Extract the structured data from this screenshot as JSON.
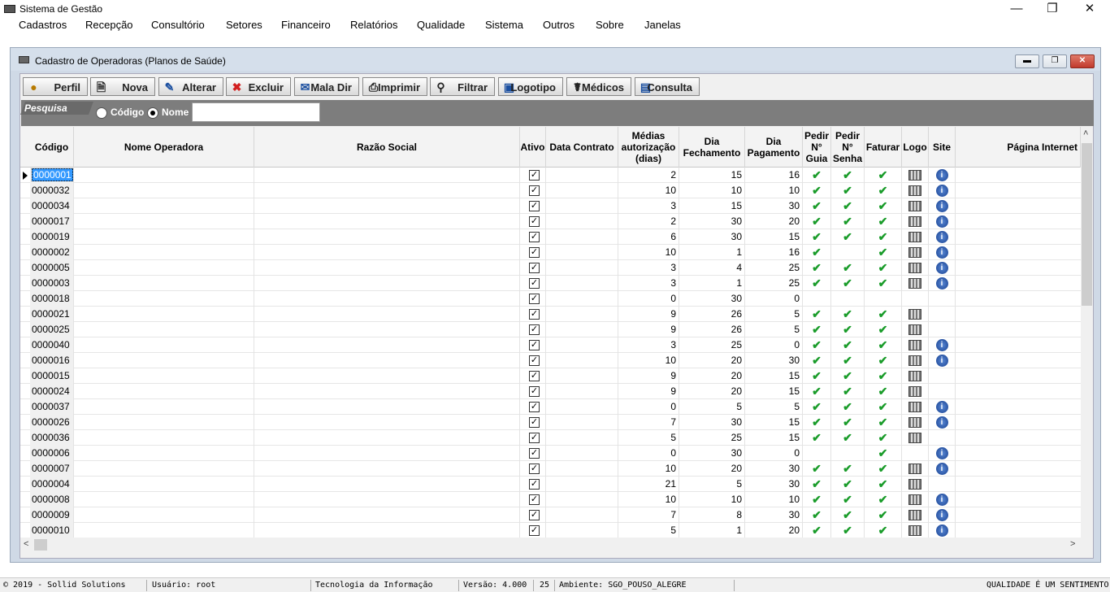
{
  "app": {
    "title": "Sistema de Gestão"
  },
  "menu": [
    "Cadastros",
    "Recepção",
    "Consultório",
    "Setores",
    "Financeiro",
    "Relatórios",
    "Qualidade",
    "Sistema",
    "Outros",
    "Sobre",
    "Janelas"
  ],
  "window": {
    "title": "Cadastro de Operadoras (Planos de Saúde)"
  },
  "toolbar": {
    "perfil": "Perfil",
    "nova": "Nova",
    "alterar": "Alterar",
    "excluir": "Excluir",
    "mala_dir": "Mala Dir",
    "imprimir": "Imprimir",
    "filtrar": "Filtrar",
    "logotipo": "Logotipo",
    "medicos": "Médicos",
    "consulta": "Consulta"
  },
  "search": {
    "label": "Pesquisa",
    "option_codigo": "Código",
    "option_nome": "Nome",
    "selected": "Nome",
    "value": ""
  },
  "columns": {
    "codigo": "Código",
    "nome": "Nome Operadora",
    "razao": "Razão Social",
    "ativo": "Ativo",
    "data_contrato": "Data Contrato",
    "medias": "Médias autorização (dias)",
    "dia_fechamento": "Dia Fechamento",
    "dia_pagamento": "Dia Pagamento",
    "pedir_guia": "Pedir N° Guia",
    "pedir_senha": "Pedir N° Senha",
    "faturar": "Faturar",
    "logo": "Logo",
    "site": "Site",
    "pagina": "Página Internet"
  },
  "rows": [
    {
      "codigo": "0000001",
      "medias": "2",
      "fech": "15",
      "pag": "16",
      "guia": true,
      "senha": true,
      "fat": true,
      "logo": true,
      "site": true
    },
    {
      "codigo": "0000032",
      "medias": "10",
      "fech": "10",
      "pag": "10",
      "guia": true,
      "senha": true,
      "fat": true,
      "logo": true,
      "site": true
    },
    {
      "codigo": "0000034",
      "medias": "3",
      "fech": "15",
      "pag": "30",
      "guia": true,
      "senha": true,
      "fat": true,
      "logo": true,
      "site": true
    },
    {
      "codigo": "0000017",
      "medias": "2",
      "fech": "30",
      "pag": "20",
      "guia": true,
      "senha": true,
      "fat": true,
      "logo": true,
      "site": true
    },
    {
      "codigo": "0000019",
      "medias": "6",
      "fech": "30",
      "pag": "15",
      "guia": true,
      "senha": true,
      "fat": true,
      "logo": true,
      "site": true
    },
    {
      "codigo": "0000002",
      "medias": "10",
      "fech": "1",
      "pag": "16",
      "guia": true,
      "senha": false,
      "fat": true,
      "logo": true,
      "site": true
    },
    {
      "codigo": "0000005",
      "medias": "3",
      "fech": "4",
      "pag": "25",
      "guia": true,
      "senha": true,
      "fat": true,
      "logo": true,
      "site": true
    },
    {
      "codigo": "0000003",
      "medias": "3",
      "fech": "1",
      "pag": "25",
      "guia": true,
      "senha": true,
      "fat": true,
      "logo": true,
      "site": true
    },
    {
      "codigo": "0000018",
      "medias": "0",
      "fech": "30",
      "pag": "0",
      "guia": false,
      "senha": false,
      "fat": false,
      "logo": false,
      "site": false
    },
    {
      "codigo": "0000021",
      "medias": "9",
      "fech": "26",
      "pag": "5",
      "guia": true,
      "senha": true,
      "fat": true,
      "logo": true,
      "site": false
    },
    {
      "codigo": "0000025",
      "medias": "9",
      "fech": "26",
      "pag": "5",
      "guia": true,
      "senha": true,
      "fat": true,
      "logo": true,
      "site": false
    },
    {
      "codigo": "0000040",
      "medias": "3",
      "fech": "25",
      "pag": "0",
      "guia": true,
      "senha": true,
      "fat": true,
      "logo": true,
      "site": true
    },
    {
      "codigo": "0000016",
      "medias": "10",
      "fech": "20",
      "pag": "30",
      "guia": true,
      "senha": true,
      "fat": true,
      "logo": true,
      "site": true
    },
    {
      "codigo": "0000015",
      "medias": "9",
      "fech": "20",
      "pag": "15",
      "guia": true,
      "senha": true,
      "fat": true,
      "logo": true,
      "site": false
    },
    {
      "codigo": "0000024",
      "medias": "9",
      "fech": "20",
      "pag": "15",
      "guia": true,
      "senha": true,
      "fat": true,
      "logo": true,
      "site": false
    },
    {
      "codigo": "0000037",
      "medias": "0",
      "fech": "5",
      "pag": "5",
      "guia": true,
      "senha": true,
      "fat": true,
      "logo": true,
      "site": true
    },
    {
      "codigo": "0000026",
      "medias": "7",
      "fech": "30",
      "pag": "15",
      "guia": true,
      "senha": true,
      "fat": true,
      "logo": true,
      "site": true
    },
    {
      "codigo": "0000036",
      "medias": "5",
      "fech": "25",
      "pag": "15",
      "guia": true,
      "senha": true,
      "fat": true,
      "logo": true,
      "site": false
    },
    {
      "codigo": "0000006",
      "medias": "0",
      "fech": "30",
      "pag": "0",
      "guia": false,
      "senha": false,
      "fat": true,
      "logo": false,
      "site": true
    },
    {
      "codigo": "0000007",
      "medias": "10",
      "fech": "20",
      "pag": "30",
      "guia": true,
      "senha": true,
      "fat": true,
      "logo": true,
      "site": true
    },
    {
      "codigo": "0000004",
      "medias": "21",
      "fech": "5",
      "pag": "30",
      "guia": true,
      "senha": true,
      "fat": true,
      "logo": true,
      "site": false
    },
    {
      "codigo": "0000008",
      "medias": "10",
      "fech": "10",
      "pag": "10",
      "guia": true,
      "senha": true,
      "fat": true,
      "logo": true,
      "site": true
    },
    {
      "codigo": "0000009",
      "medias": "7",
      "fech": "8",
      "pag": "30",
      "guia": true,
      "senha": true,
      "fat": true,
      "logo": true,
      "site": true
    },
    {
      "codigo": "0000010",
      "medias": "5",
      "fech": "1",
      "pag": "20",
      "guia": true,
      "senha": true,
      "fat": true,
      "logo": true,
      "site": true
    }
  ],
  "status": {
    "copyright": "© 2019 - Sollid Solutions",
    "usuario": "Usuário: root",
    "setor": "Tecnologia da Informação",
    "versao": "Versão: 4.000",
    "numero": "25",
    "ambiente": "Ambiente: SGO_POUSO_ALEGRE",
    "slogan": "QUALIDADE É UM SENTIMENTO"
  }
}
